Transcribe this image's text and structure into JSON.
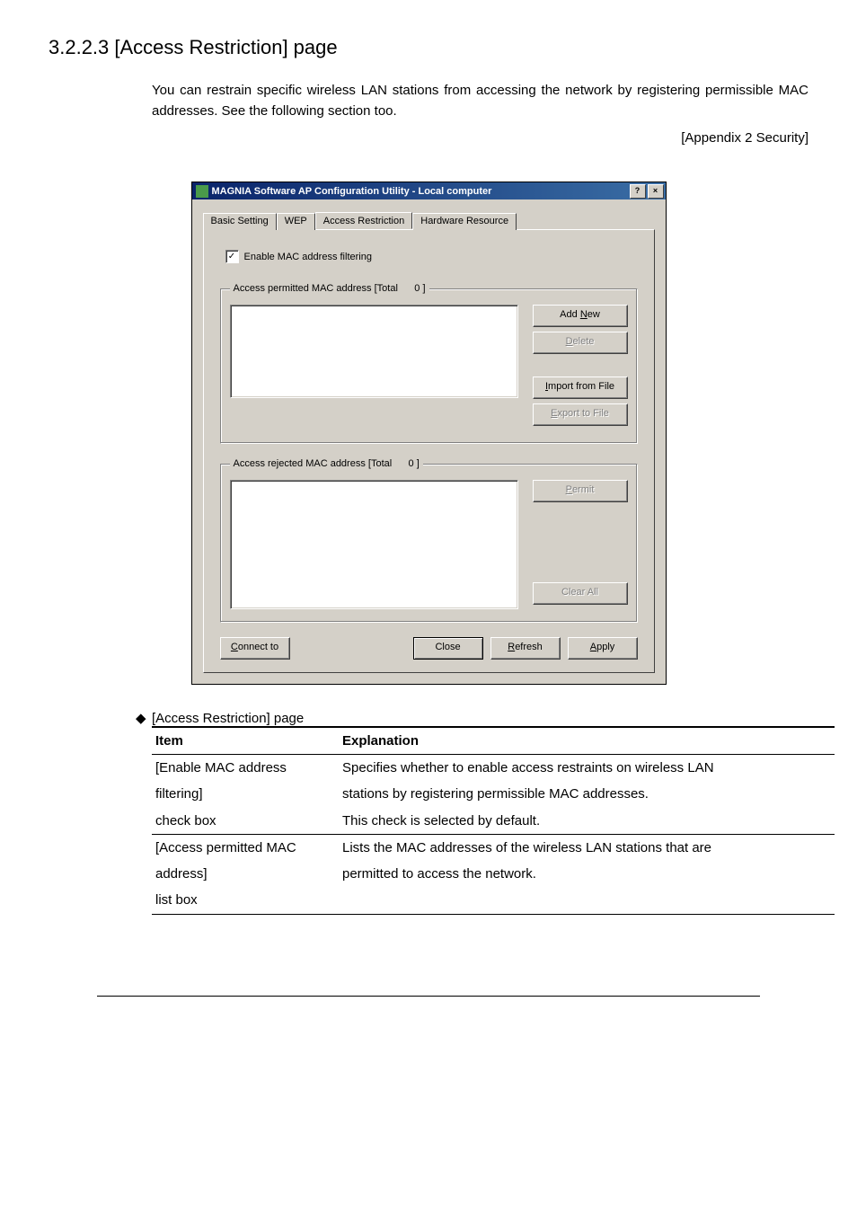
{
  "section_heading": "3.2.2.3  [Access Restriction] page",
  "intro_paragraph": "You can restrain specific wireless LAN stations from accessing the network by registering permissible MAC addresses. See the following section too.",
  "appendix_ref": "[Appendix 2 Security]",
  "dialog": {
    "title": "MAGNIA Software AP Configuration Utility - Local computer",
    "help_caption": "?",
    "close_caption": "×",
    "tabs": {
      "basic": "Basic Setting",
      "wep": "WEP",
      "access": "Access Restriction",
      "hardware": "Hardware Resource"
    },
    "enable_label": "Enable MAC address filtering",
    "permitted_legend_prefix": "Access permitted MAC address     [Total",
    "permitted_count": "0",
    "permitted_legend_suffix": "]",
    "rejected_legend_prefix": "Access rejected MAC address     [Total",
    "rejected_count": "0",
    "rejected_legend_suffix": "]",
    "buttons": {
      "add_new_pre": "Add ",
      "add_new_u": "N",
      "add_new_post": "ew",
      "delete_u": "D",
      "delete_post": "elete",
      "import_u": "I",
      "import_post": "mport from File",
      "export_u": "E",
      "export_post": "xport to File",
      "permit_u": "P",
      "permit_post": "ermit",
      "clear_all": "Clear All",
      "connect_u": "C",
      "connect_post": "onnect to",
      "close": "Close",
      "refresh_u": "R",
      "refresh_post": "efresh",
      "apply_u": "A",
      "apply_post": "pply"
    }
  },
  "table_caption": "[Access Restriction] page",
  "diamond": "◆",
  "table": {
    "h_item": "Item",
    "h_exp": "Explanation",
    "r1_item_l1": "[Enable MAC address",
    "r1_item_l2": "filtering]",
    "r1_item_l3": "check box",
    "r1_exp_l1": "Specifies whether to enable access restraints on wireless LAN",
    "r1_exp_l2": "stations by registering permissible MAC addresses.",
    "r1_exp_l3": "This check is selected by default.",
    "r2_item_l1": "[Access permitted MAC",
    "r2_item_l2": "address]",
    "r2_item_l3": "list box",
    "r2_exp_l1": "Lists the MAC addresses of the wireless LAN stations that are",
    "r2_exp_l2": "permitted to access the network."
  }
}
